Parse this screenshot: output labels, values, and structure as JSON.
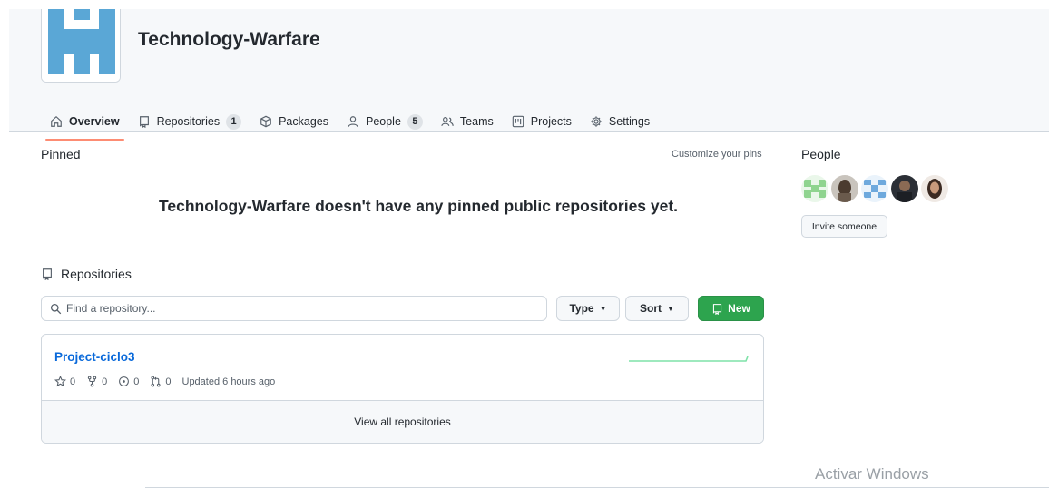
{
  "org": {
    "name": "Technology-Warfare"
  },
  "tabs": [
    {
      "label": "Overview",
      "count": null,
      "icon": "home-icon"
    },
    {
      "label": "Repositories",
      "count": "1",
      "icon": "repo-icon"
    },
    {
      "label": "Packages",
      "count": null,
      "icon": "package-icon"
    },
    {
      "label": "People",
      "count": "5",
      "icon": "person-icon"
    },
    {
      "label": "Teams",
      "count": null,
      "icon": "people-icon"
    },
    {
      "label": "Projects",
      "count": null,
      "icon": "project-icon"
    },
    {
      "label": "Settings",
      "count": null,
      "icon": "gear-icon"
    }
  ],
  "pinned": {
    "title": "Pinned",
    "customize_label": "Customize your pins",
    "empty_message": "Technology-Warfare doesn't have any pinned public repositories yet."
  },
  "repositories": {
    "title": "Repositories",
    "search_placeholder": "Find a repository...",
    "type_label": "Type",
    "sort_label": "Sort",
    "new_label": "New",
    "items": [
      {
        "name": "Project-ciclo3",
        "stars": "0",
        "forks": "0",
        "issues": "0",
        "pulls": "0",
        "updated": "Updated 6 hours ago"
      }
    ],
    "view_all_label": "View all repositories"
  },
  "people": {
    "title": "People",
    "invite_label": "Invite someone"
  },
  "watermark": "Activar Windows",
  "colors": {
    "accent": "#2da44e",
    "link": "#0969da",
    "tab_underline": "#fd8c73"
  }
}
